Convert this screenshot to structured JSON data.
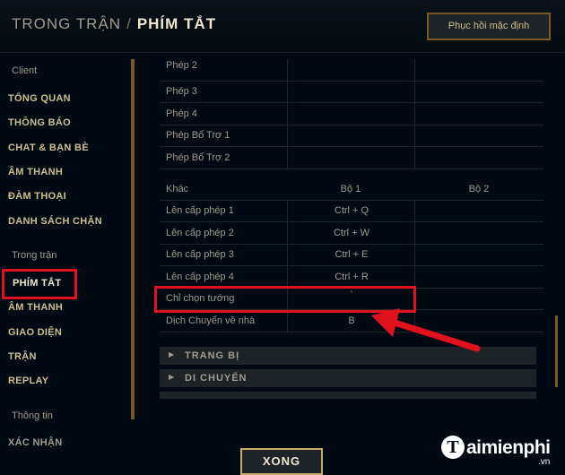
{
  "header": {
    "breadcrumb_parent": "TRONG TRẬN",
    "breadcrumb_separator": "/",
    "breadcrumb_current": "PHÍM TẮT",
    "reset_button": "Phục hồi mặc định"
  },
  "sidebar": {
    "sections": [
      "Client",
      "Trong trận",
      "Thông tin"
    ],
    "client_items": [
      "TỔNG QUAN",
      "THÔNG BÁO",
      "CHAT & BẠN BÈ",
      "ÂM THANH",
      "ĐÀM THOẠI",
      "DANH SÁCH CHẶN"
    ],
    "ingame_items": [
      "PHÍM TẮT",
      "ÂM THANH",
      "GIAO DIỆN",
      "TRẬN",
      "REPLAY"
    ],
    "info_items": [
      "XÁC NHẬN"
    ]
  },
  "table_top": [
    {
      "label": "Phép 2",
      "bo1": "",
      "bo2": ""
    },
    {
      "label": "Phép 3",
      "bo1": "",
      "bo2": ""
    },
    {
      "label": "Phép 4",
      "bo1": "",
      "bo2": ""
    },
    {
      "label": "Phép Bổ Trợ 1",
      "bo1": "",
      "bo2": ""
    },
    {
      "label": "Phép Bổ Trợ 2",
      "bo1": "",
      "bo2": ""
    }
  ],
  "table_other": {
    "header": {
      "label": "Khác",
      "bo1": "Bộ 1",
      "bo2": "Bộ 2"
    },
    "rows": [
      {
        "label": "Lên cấp phép 1",
        "bo1": "Ctrl + Q",
        "bo2": ""
      },
      {
        "label": "Lên cấp phép 2",
        "bo1": "Ctrl + W",
        "bo2": ""
      },
      {
        "label": "Lên cấp phép 3",
        "bo1": "Ctrl + E",
        "bo2": ""
      },
      {
        "label": "Lên cấp phép 4",
        "bo1": "Ctrl + R",
        "bo2": ""
      },
      {
        "label": "Chỉ chọn tướng",
        "bo1": "`",
        "bo2": ""
      },
      {
        "label": "Dịch Chuyển về nhà",
        "bo1": "B",
        "bo2": ""
      }
    ]
  },
  "accordions": [
    "TRANG BỊ",
    "DI CHUYỂN"
  ],
  "done_button": "XONG",
  "watermark": {
    "text": "aimienphi",
    "logo_letter": "T",
    "suffix": ".vn"
  },
  "colors": {
    "background": "#010a13",
    "gold": "#c8aa6e",
    "highlight": "#e0121d"
  }
}
